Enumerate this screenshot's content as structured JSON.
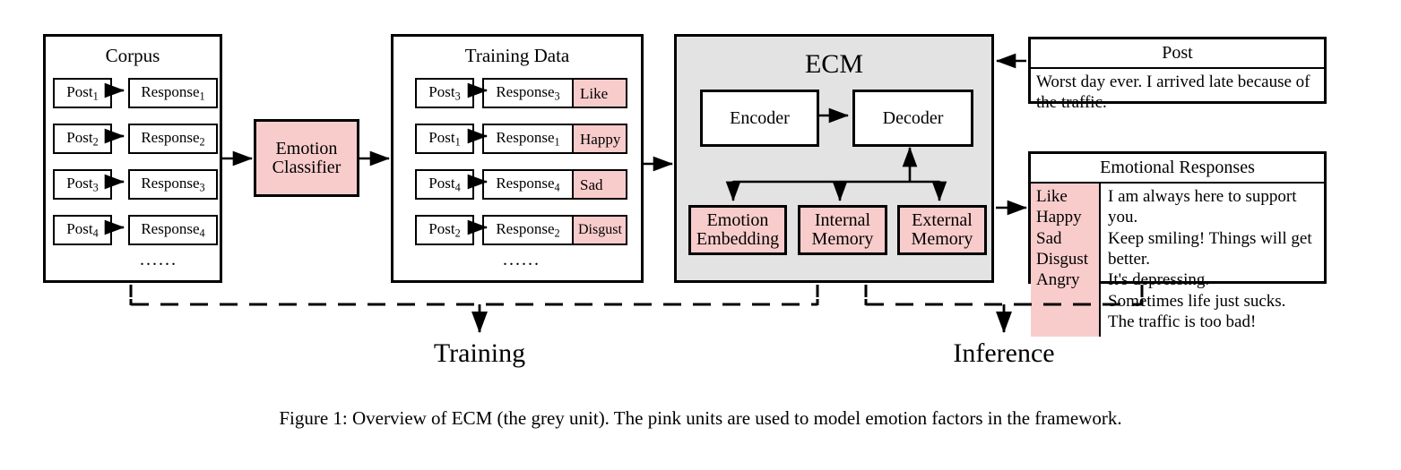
{
  "figure": {
    "caption": "Figure 1: Overview of ECM (the grey unit). The pink units are used to model emotion factors in the framework.",
    "colors": {
      "pink": "#f9cccc",
      "grey": "#e3e3e3",
      "stroke": "#000000",
      "background": "#ffffff"
    }
  },
  "corpus": {
    "title": "Corpus",
    "ellipsis": "......",
    "rows": [
      {
        "post": "Post",
        "post_sub": "1",
        "response": "Response",
        "response_sub": "1"
      },
      {
        "post": "Post",
        "post_sub": "2",
        "response": "Response",
        "response_sub": "2"
      },
      {
        "post": "Post",
        "post_sub": "3",
        "response": "Response",
        "response_sub": "3"
      },
      {
        "post": "Post",
        "post_sub": "4",
        "response": "Response",
        "response_sub": "4"
      }
    ]
  },
  "classifier": {
    "line1": "Emotion",
    "line2": "Classifier"
  },
  "training_data": {
    "title": "Training Data",
    "ellipsis": "......",
    "rows": [
      {
        "post": "Post",
        "post_sub": "3",
        "response": "Response",
        "response_sub": "3",
        "emotion": "Like"
      },
      {
        "post": "Post",
        "post_sub": "1",
        "response": "Response",
        "response_sub": "1",
        "emotion": "Happy"
      },
      {
        "post": "Post",
        "post_sub": "4",
        "response": "Response",
        "response_sub": "4",
        "emotion": "Sad"
      },
      {
        "post": "Post",
        "post_sub": "2",
        "response": "Response",
        "response_sub": "2",
        "emotion": "Disgust"
      }
    ]
  },
  "ecm": {
    "title": "ECM",
    "encoder": "Encoder",
    "decoder": "Decoder",
    "modules": [
      {
        "line1": "Emotion",
        "line2": "Embedding"
      },
      {
        "line1": "Internal",
        "line2": "Memory"
      },
      {
        "line1": "External",
        "line2": "Memory"
      }
    ]
  },
  "post_panel": {
    "title": "Post",
    "text": "Worst day ever. I arrived late because of the traffic."
  },
  "emotional_responses": {
    "title": "Emotional Responses",
    "emotions": [
      "Like",
      "Happy",
      "Sad",
      "Disgust",
      "Angry"
    ],
    "responses": [
      "I am always here to support you.",
      "Keep smiling! Things will get better.",
      "It's depressing.",
      "Sometimes life just sucks.",
      "The traffic is too bad!"
    ]
  },
  "stages": {
    "training": "Training",
    "inference": "Inference"
  }
}
